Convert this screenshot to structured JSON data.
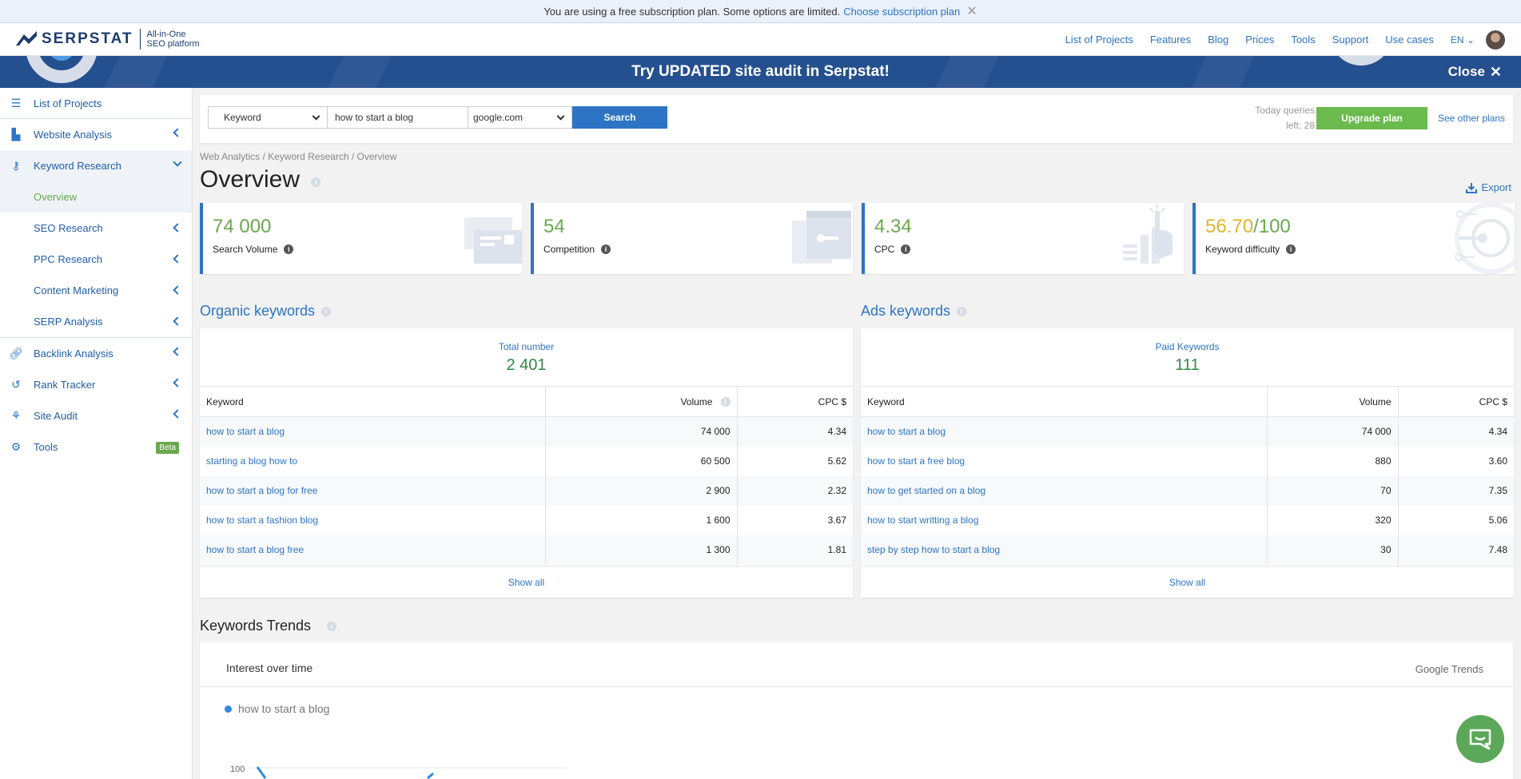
{
  "notice": {
    "text": "You are using a free subscription plan. Some options are limited.",
    "link": "Choose subscription plan",
    "close": "✕"
  },
  "header": {
    "logo_text": "SERPSTAT",
    "logo_sub_1": "All-in-One",
    "logo_sub_2": "SEO platform",
    "nav": [
      "List of Projects",
      "Features",
      "Blog",
      "Prices",
      "Tools",
      "Support",
      "Use cases"
    ],
    "lang": "EN"
  },
  "banner": {
    "text": "Try UPDATED site audit in Serpstat!",
    "close": "Close"
  },
  "sidebar": {
    "items": [
      {
        "label": "List of Projects"
      },
      {
        "label": "Website Analysis"
      },
      {
        "label": "Keyword Research"
      },
      {
        "label": "Overview"
      },
      {
        "label": "SEO Research"
      },
      {
        "label": "PPC Research"
      },
      {
        "label": "Content Marketing"
      },
      {
        "label": "SERP Analysis"
      },
      {
        "label": "Backlink Analysis"
      },
      {
        "label": "Rank Tracker"
      },
      {
        "label": "Site Audit"
      },
      {
        "label": "Tools"
      }
    ],
    "beta": "Beta"
  },
  "search": {
    "type": "Keyword",
    "query": "how to start a blog",
    "domain": "google.com",
    "button": "Search",
    "queries_line1": "Today queries",
    "queries_line2": "left: 28",
    "upgrade": "Upgrade plan",
    "see_plans": "See other plans"
  },
  "breadcrumb": "Web Analytics / Keyword Research / Overview",
  "page_title": "Overview",
  "export": "Export",
  "metrics": [
    {
      "value": "74 000",
      "label": "Search Volume"
    },
    {
      "value": "54",
      "label": "Competition"
    },
    {
      "value": "4.34",
      "label": "CPC"
    },
    {
      "value_a": "56.70",
      "value_b": "/100",
      "label": "Keyword difficulty"
    }
  ],
  "organic": {
    "title": "Organic keywords",
    "total_label": "Total number",
    "total_value": "2 401",
    "columns": [
      "Keyword",
      "Volume",
      "CPC $"
    ],
    "rows": [
      [
        "how to start a blog",
        "74 000",
        "4.34"
      ],
      [
        "starting a blog how to",
        "60 500",
        "5.62"
      ],
      [
        "how to start a blog for free",
        "2 900",
        "2.32"
      ],
      [
        "how to start a fashion blog",
        "1 600",
        "3.67"
      ],
      [
        "how to start a blog free",
        "1 300",
        "1.81"
      ]
    ],
    "show_all": "Show all"
  },
  "ads": {
    "title": "Ads keywords",
    "total_label": "Paid Keywords",
    "total_value": "111",
    "columns": [
      "Keyword",
      "Volume",
      "CPC $"
    ],
    "rows": [
      [
        "how to start a blog",
        "74 000",
        "4.34"
      ],
      [
        "how to start a free blog",
        "880",
        "3.60"
      ],
      [
        "how to get started on a blog",
        "70",
        "7.35"
      ],
      [
        "how to start writting a blog",
        "320",
        "5.06"
      ],
      [
        "step by step how to start a blog",
        "30",
        "7.48"
      ]
    ],
    "show_all": "Show all"
  },
  "trends": {
    "section_title": "Keywords Trends",
    "title": "Interest over time",
    "brand": "Google Trends",
    "legend": "how to start a blog",
    "axis_top": "100"
  },
  "colors": {
    "accent": "#2d74c4",
    "green": "#6aa84f",
    "banner": "#25508f",
    "difficulty": "#e2b42b"
  }
}
